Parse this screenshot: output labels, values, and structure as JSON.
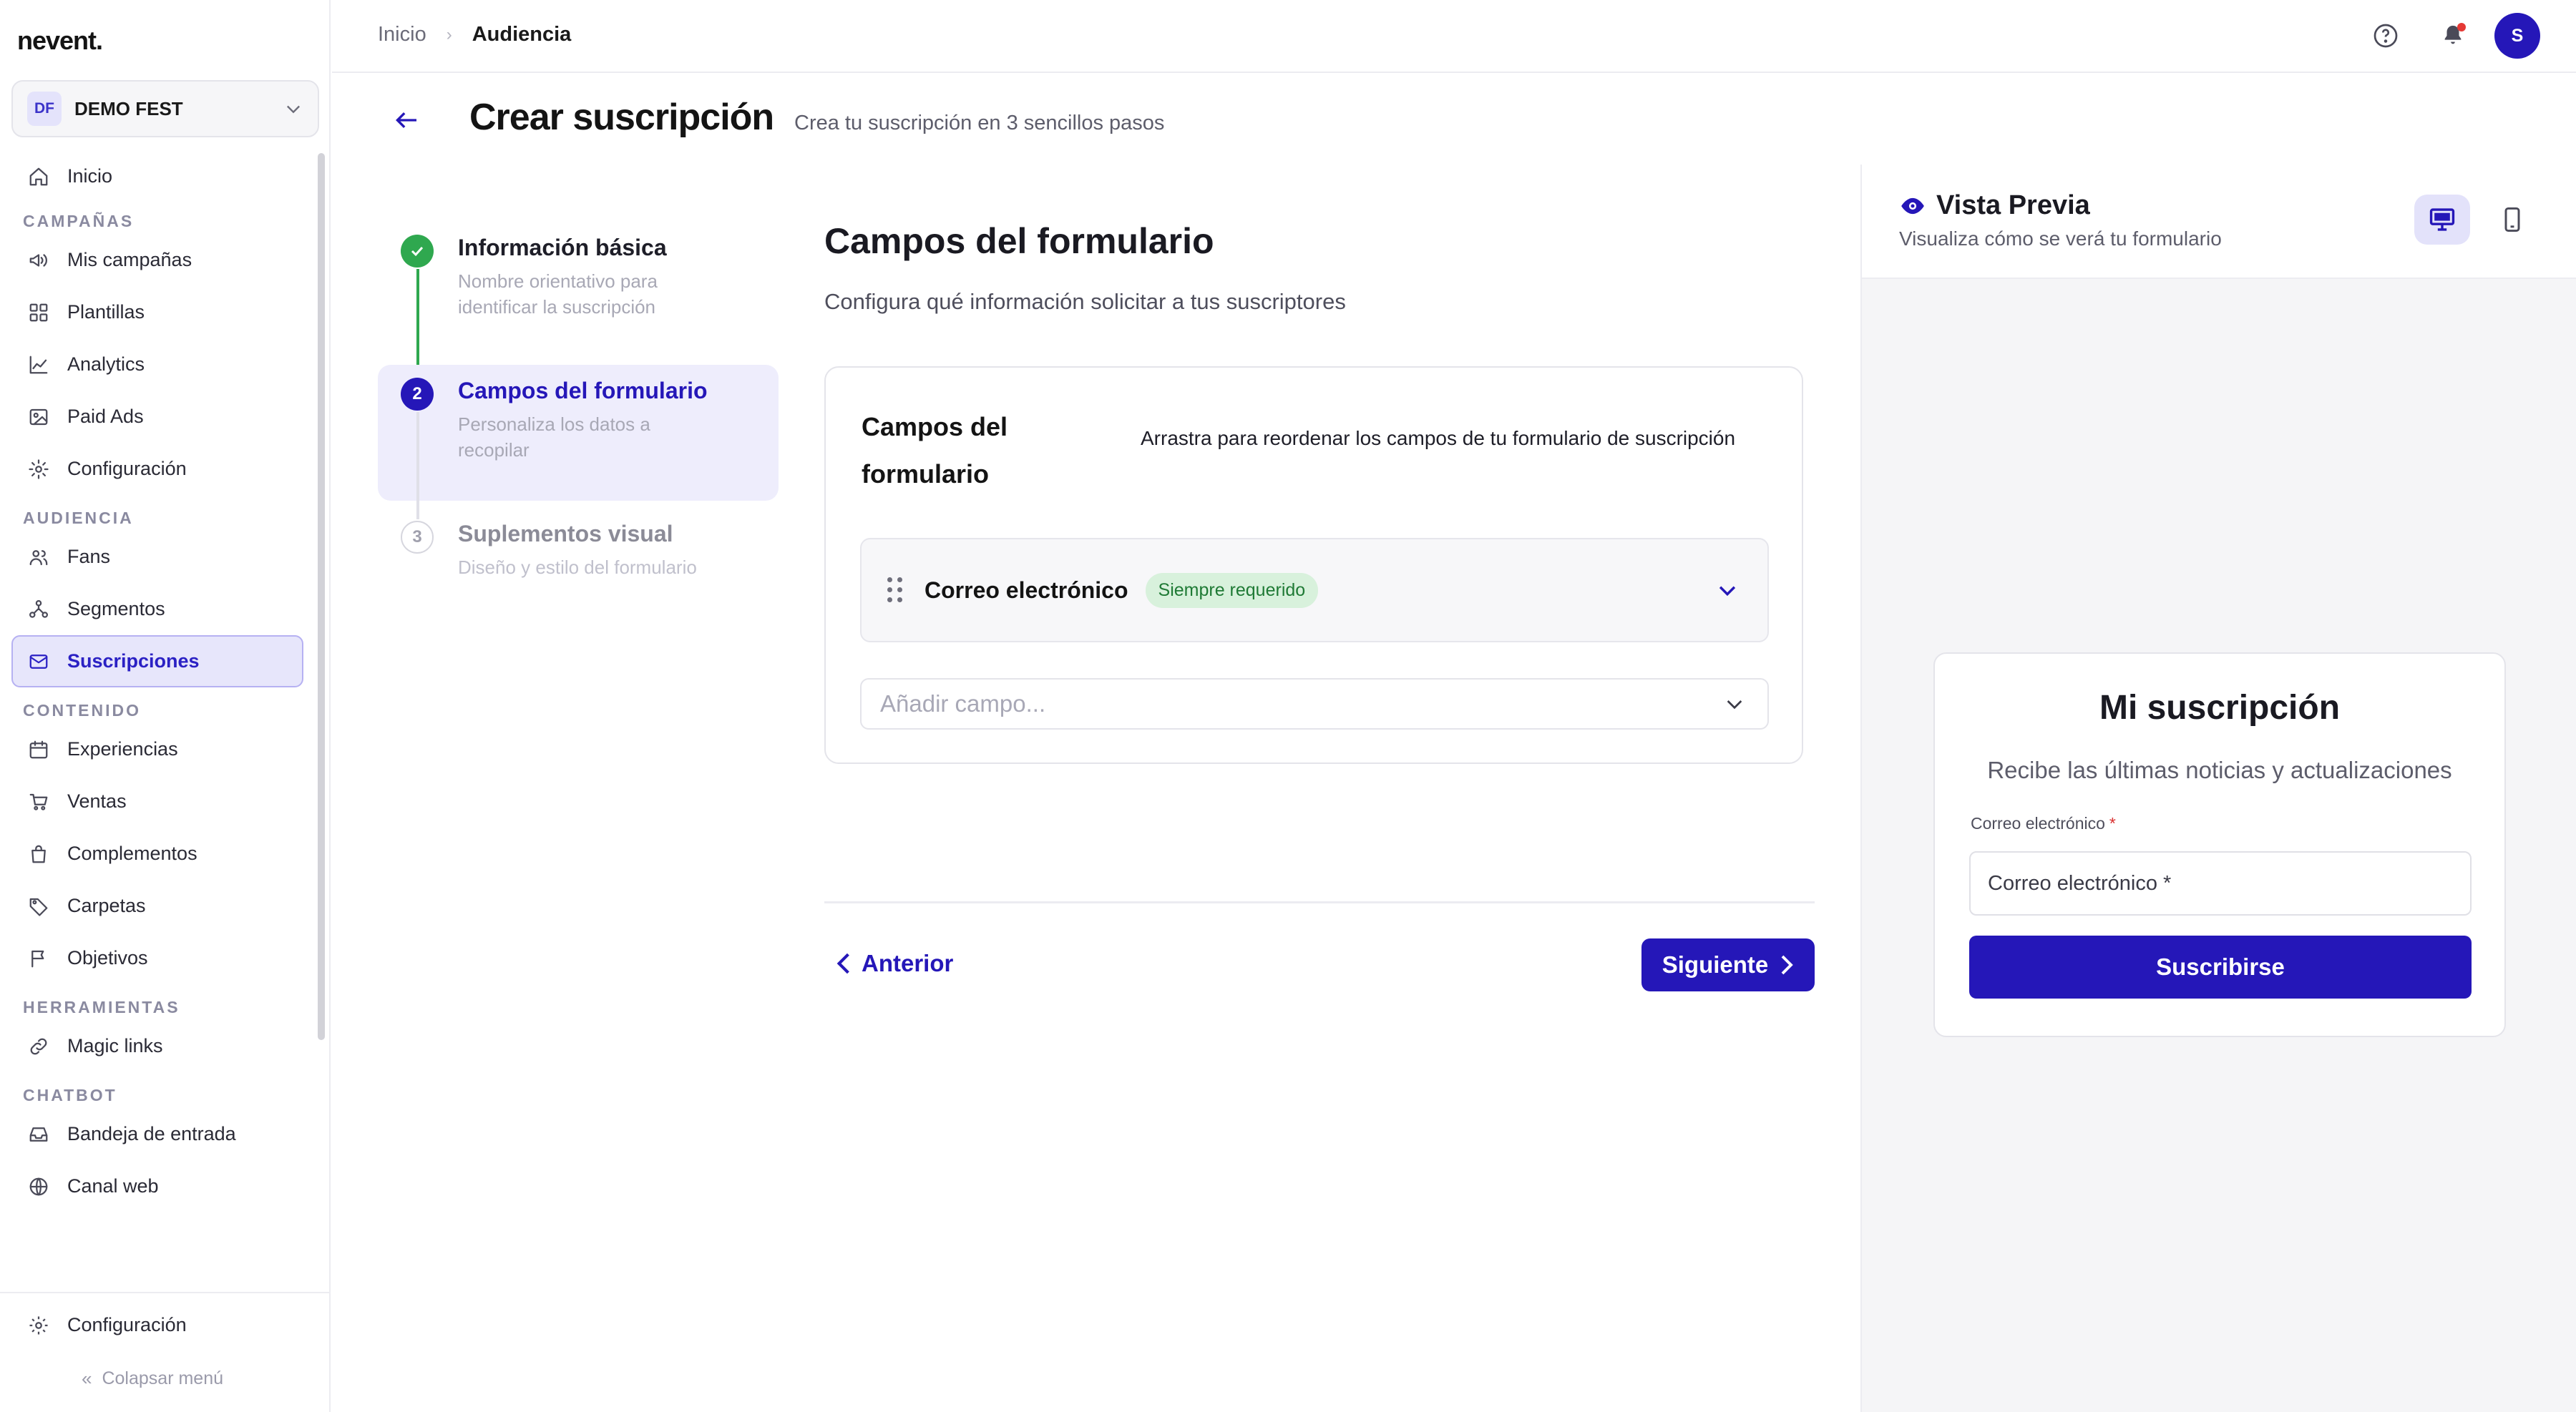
{
  "app": {
    "logo": "nevent."
  },
  "org": {
    "badge": "DF",
    "name": "DEMO FEST"
  },
  "sidebar": {
    "items": [
      {
        "label": "Inicio",
        "icon": "home-icon"
      },
      {
        "section": "CAMPAÑAS"
      },
      {
        "label": "Mis campañas",
        "icon": "megaphone-icon"
      },
      {
        "label": "Plantillas",
        "icon": "grid-icon"
      },
      {
        "label": "Analytics",
        "icon": "chart-line-icon"
      },
      {
        "label": "Paid Ads",
        "icon": "image-icon"
      },
      {
        "label": "Configuración",
        "icon": "gear-icon"
      },
      {
        "section": "AUDIENCIA"
      },
      {
        "label": "Fans",
        "icon": "users-icon"
      },
      {
        "label": "Segmentos",
        "icon": "segments-icon"
      },
      {
        "label": "Suscripciones",
        "icon": "mail-icon",
        "active": true
      },
      {
        "section": "CONTENIDO"
      },
      {
        "label": "Experiencias",
        "icon": "calendar-icon"
      },
      {
        "label": "Ventas",
        "icon": "cart-icon"
      },
      {
        "label": "Complementos",
        "icon": "bag-icon"
      },
      {
        "label": "Carpetas",
        "icon": "tag-icon"
      },
      {
        "label": "Objetivos",
        "icon": "flag-icon"
      },
      {
        "section": "HERRAMIENTAS"
      },
      {
        "label": "Magic links",
        "icon": "link-icon"
      },
      {
        "section": "CHATBOT"
      },
      {
        "label": "Bandeja de entrada",
        "icon": "inbox-icon"
      },
      {
        "label": "Canal web",
        "icon": "globe-icon"
      }
    ],
    "bottom_settings": "Configuración",
    "collapse": "Colapsar menú"
  },
  "breadcrumb": {
    "home": "Inicio",
    "current": "Audiencia"
  },
  "header": {
    "title": "Crear suscripción",
    "subtitle": "Crea tu suscripción en 3 sencillos pasos"
  },
  "stepper": [
    {
      "number": "1",
      "title": "Información básica",
      "desc": "Nombre orientativo para identificar la suscripción",
      "state": "done"
    },
    {
      "number": "2",
      "title": "Campos del formulario",
      "desc": "Personaliza los datos a recopilar",
      "state": "current"
    },
    {
      "number": "3",
      "title": "Suplementos visual",
      "desc": "Diseño y estilo del formulario",
      "state": "pending"
    }
  ],
  "form": {
    "title": "Campos del formulario",
    "subtitle": "Configura qué información solicitar a tus suscriptores",
    "card_title": "Campos del formulario",
    "card_desc": "Arrastra para reordenar los campos de tu formulario de suscripción",
    "fields": [
      {
        "label": "Correo electrónico",
        "badge": "Siempre requerido"
      }
    ],
    "add_placeholder": "Añadir campo...",
    "prev": "Anterior",
    "next": "Siguiente"
  },
  "preview": {
    "title": "Vista Previa",
    "subtitle": "Visualiza cómo se verá tu formulario",
    "card_title": "Mi suscripción",
    "card_desc": "Recibe las últimas noticias y actualizaciones",
    "field_label": "Correo electrónico",
    "required_mark": "*",
    "input_placeholder": "Correo electrónico *",
    "button": "Suscribirse"
  },
  "colors": {
    "primary": "#2517b8",
    "success": "#2fa84f",
    "notification": "#e53935"
  }
}
